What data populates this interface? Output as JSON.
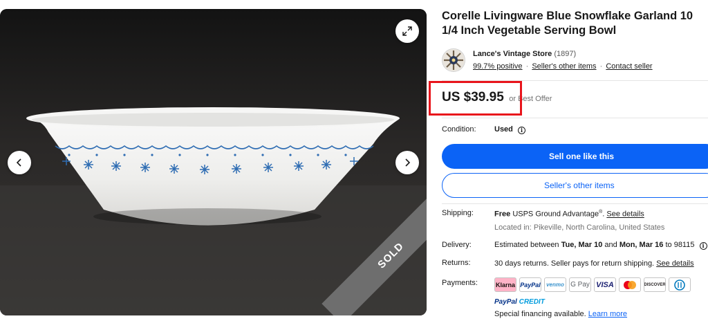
{
  "listing": {
    "title": "Corelle Livingware Blue Snowflake Garland 10 1/4 Inch Vegetable Serving Bowl",
    "sold_badge": "SOLD"
  },
  "seller": {
    "name": "Lance's Vintage Store",
    "feedback_count": "(1897)",
    "positive": "99.7% positive",
    "other_items_link": "Seller's other items",
    "contact_link": "Contact seller",
    "separator": "·"
  },
  "price": {
    "amount": "US $39.95",
    "best_offer": "or Best Offer"
  },
  "condition": {
    "label": "Condition:",
    "value": "Used",
    "info_glyph": "i"
  },
  "actions": {
    "sell_one": "Sell one like this",
    "other_items": "Seller's other items"
  },
  "shipping": {
    "label": "Shipping:",
    "free": "Free",
    "service": "USPS Ground Advantage",
    "reg_mark": "®",
    "details_link": "See details",
    "location": "Located in: Pikeville, North Carolina, United States"
  },
  "delivery": {
    "label": "Delivery:",
    "prefix": "Estimated between",
    "start": "Tue, Mar 10",
    "and": "and",
    "end": "Mon, Mar 16",
    "to": "to 98115"
  },
  "returns": {
    "label": "Returns:",
    "text": "30 days returns. Seller pays for return shipping.",
    "details_link": "See details"
  },
  "payments": {
    "label": "Payments:",
    "methods": [
      "Klarna",
      "PayPal",
      "venmo",
      "G Pay",
      "VISA",
      "",
      "DISCOVER",
      ""
    ],
    "paypal_credit_1": "PayPal",
    "paypal_credit_2": "CREDIT",
    "financing": "Special financing available.",
    "learn_more": "Learn more"
  },
  "colors": {
    "primary_blue": "#0b63f6",
    "highlight_red": "#e8141b",
    "text": "#191919",
    "muted": "#707070"
  },
  "icons": {
    "expand": "expand-icon",
    "prev": "chevron-left-icon",
    "next": "chevron-right-icon",
    "info": "info-icon"
  }
}
